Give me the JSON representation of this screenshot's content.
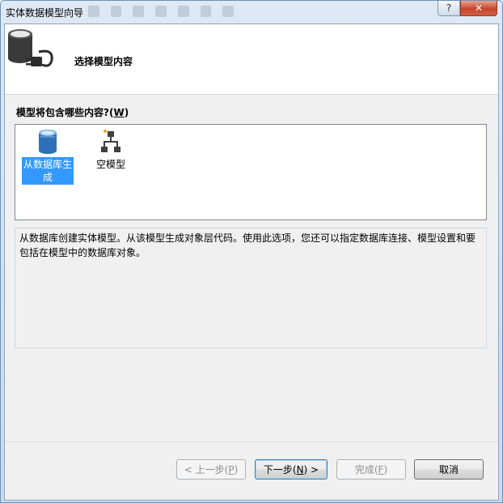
{
  "window": {
    "title": "实体数据模型向导",
    "help_glyph": "?",
    "close_glyph": "✕"
  },
  "header": {
    "title": "选择模型内容",
    "icon": "database-plug-icon"
  },
  "prompt": {
    "label": "模型将包含哪些内容?",
    "accel_open": "(",
    "accel_key": "W",
    "accel_close": ")"
  },
  "model_options": [
    {
      "label": "从数据库生成",
      "icon": "database-icon",
      "selected": true
    },
    {
      "label": "空模型",
      "icon": "empty-model-icon",
      "selected": false
    }
  ],
  "description": "从数据库创建实体模型。从该模型生成对象层代码。使用此选项，您还可以指定数据库连接、模型设置和要包括在模型中的数据库对象。",
  "buttons": {
    "back": {
      "pre": "< 上一步(",
      "key": "P",
      "post": ")"
    },
    "next": {
      "pre": "下一步(",
      "key": "N",
      "post": ") >"
    },
    "finish": {
      "pre": "完成(",
      "key": "F",
      "post": ")"
    },
    "cancel": {
      "label": "取消"
    }
  },
  "colors": {
    "selection": "#3399ff",
    "titlebar": "#c9d9ec",
    "close_button": "#c7442b"
  }
}
